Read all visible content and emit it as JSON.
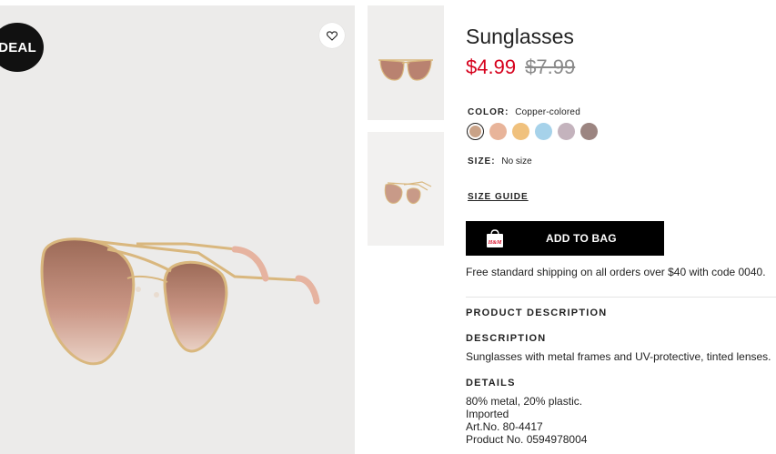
{
  "badge": {
    "label": "DEAL"
  },
  "favorite": {
    "icon": "heart-icon"
  },
  "product": {
    "title": "Sunglasses",
    "price_sale": "$4.99",
    "price_original": "$7.99"
  },
  "color": {
    "label": "COLOR:",
    "value": "Copper-colored",
    "swatches": [
      "#c9a287",
      "#e8b49a",
      "#f0c17d",
      "#a6d2ea",
      "#c4b3bd",
      "#9c8581"
    ],
    "selected_index": 0
  },
  "size": {
    "label": "SIZE:",
    "value": "No size"
  },
  "size_guide": {
    "label": "SIZE GUIDE"
  },
  "add_to_bag": {
    "label": "ADD TO BAG",
    "icon": "shopping-bag-icon",
    "brand": "H&M"
  },
  "shipping": {
    "text": "Free standard shipping on all orders over $40 with code 0040."
  },
  "sections": {
    "product_description": "PRODUCT DESCRIPTION",
    "description_heading": "DESCRIPTION",
    "description_text": "Sunglasses with metal frames and UV-protective, tinted lenses.",
    "details_heading": "DETAILS",
    "details": [
      "80% metal, 20% plastic.",
      "Imported",
      "Art.No. 80-4417",
      "Product No. 0594978004"
    ]
  },
  "colors": {
    "accent_red": "#d6001c",
    "button_black": "#000000"
  }
}
